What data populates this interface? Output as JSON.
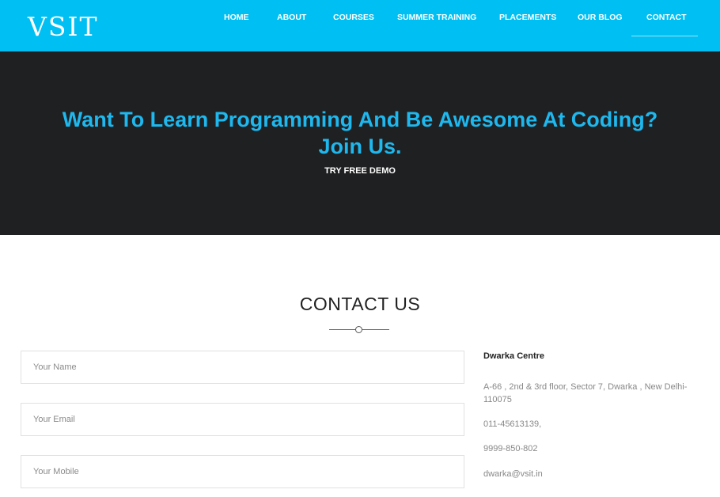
{
  "header": {
    "logo": "VSIT",
    "nav": [
      {
        "label": "HOME"
      },
      {
        "label": "ABOUT"
      },
      {
        "label": "COURSES"
      },
      {
        "label": "SUMMER TRAINING"
      },
      {
        "label": "PLACEMENTS"
      },
      {
        "label": "OUR BLOG"
      },
      {
        "label": "CONTACT"
      }
    ],
    "active_item": "CONTACT",
    "colors": {
      "background": "#00bff3",
      "text": "#ffffff"
    }
  },
  "hero": {
    "title_line1": "Want To Learn Programming And Be Awesome At Coding?",
    "title_line2": "Join Us.",
    "cta": "TRY FREE DEMO",
    "colors": {
      "background": "#1f2022",
      "title": "#1eb8ee",
      "cta": "#ffffff"
    }
  },
  "contact": {
    "title": "CONTACT US",
    "form": {
      "name_placeholder": "Your Name",
      "email_placeholder": "Your Email",
      "mobile_placeholder": "Your Mobile"
    },
    "centre": {
      "name": "Dwarka Centre",
      "address": "A-66 , 2nd & 3rd floor, Sector 7, Dwarka , New Delhi-110075",
      "phone1": "011-45613139,",
      "phone2": "9999-850-802",
      "email": "dwarka@vsit.in"
    }
  }
}
